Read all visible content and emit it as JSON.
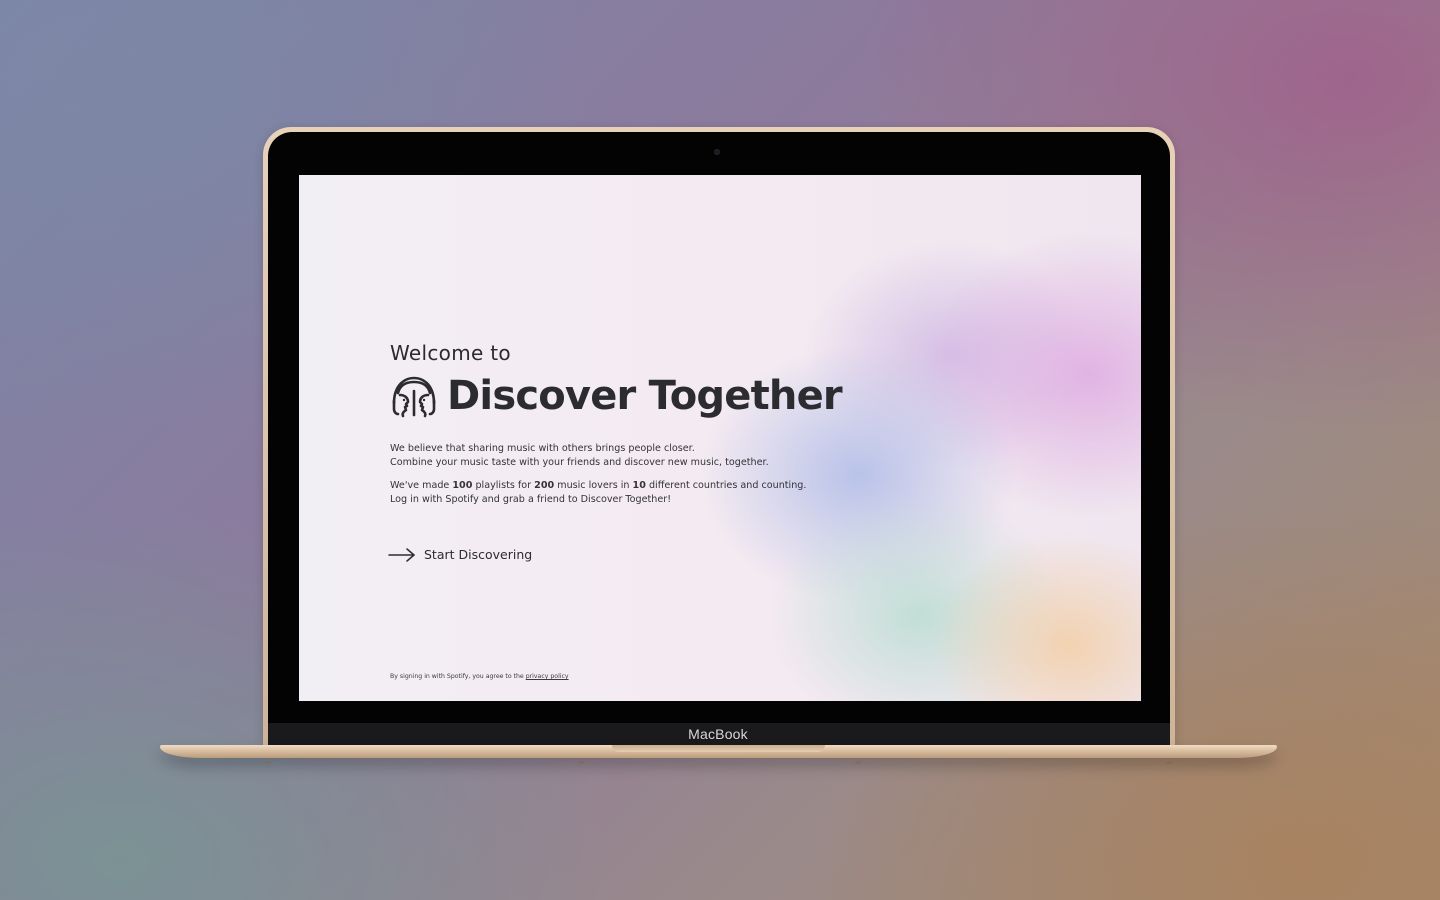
{
  "device": {
    "brand_label": "MacBook"
  },
  "hero": {
    "welcome": "Welcome to",
    "title": "Discover Together"
  },
  "intro": {
    "line1": "We believe that sharing music with others brings people closer.",
    "line2": "Combine your music taste with your friends and discover new music, together."
  },
  "stats": {
    "prefix": "We've made ",
    "playlists_count": "100",
    "mid1": " playlists for ",
    "lovers_count": "200",
    "mid2": " music lovers in ",
    "countries_count": "10",
    "suffix": " different countries and counting.",
    "line2": "Log in with Spotify and grab a friend to Discover Together!"
  },
  "cta": {
    "label": "Start Discovering",
    "icon": "arrow-right-icon"
  },
  "footer": {
    "text": "By signing in with Spotify, you agree to the ",
    "link_label": "privacy policy"
  },
  "colors": {
    "text": "#2c2c30",
    "device_gold": "#e7d2b9",
    "bezel": "#030303"
  }
}
